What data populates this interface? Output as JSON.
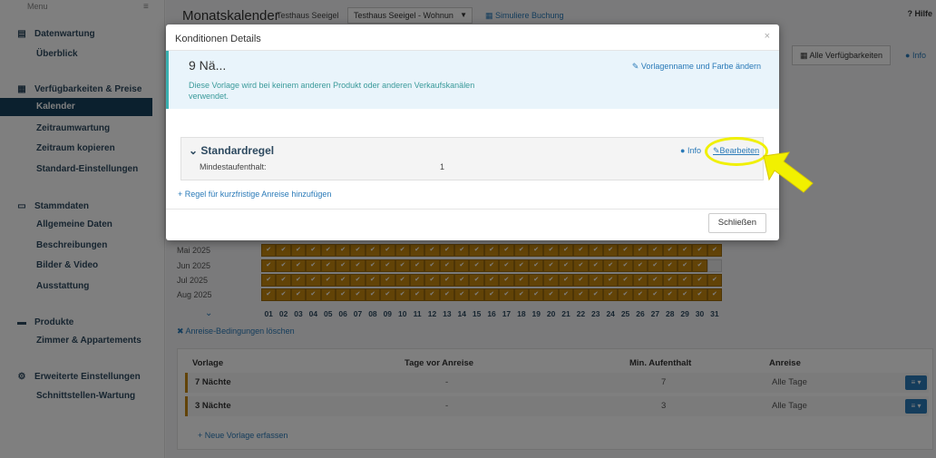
{
  "sidebar": {
    "menu_label": "Menu",
    "sections": [
      {
        "label": "Datenwartung",
        "items": [
          "Überblick"
        ]
      },
      {
        "label": "Verfügbarkeiten & Preise",
        "items": [
          "Kalender",
          "Zeitraumwartung",
          "Zeitraum kopieren",
          "Standard-Einstellungen"
        ]
      },
      {
        "label": "Stammdaten",
        "items": [
          "Allgemeine Daten",
          "Beschreibungen",
          "Bilder & Video",
          "Ausstattung"
        ]
      },
      {
        "label": "Produkte",
        "items": [
          "Zimmer & Appartements"
        ]
      },
      {
        "label": "Erweiterte Einstellungen",
        "items": [
          "Schnittstellen-Wartung"
        ]
      }
    ],
    "active_item": "Kalender"
  },
  "header": {
    "title": "Monatskalender",
    "property": "Testhaus Seeigel",
    "unit_select": "Testhaus Seeigel - Wohnun",
    "simulate": "Simuliere Buchung",
    "help": "? Hilfe",
    "availability_button": "Alle Verfügbarkeiten",
    "info_link": "Info"
  },
  "calendar": {
    "months": [
      "Mai 2025",
      "Jun 2025",
      "Jul 2025",
      "Aug 2025"
    ],
    "days": [
      "01",
      "02",
      "03",
      "04",
      "05",
      "06",
      "07",
      "08",
      "09",
      "10",
      "11",
      "12",
      "13",
      "14",
      "15",
      "16",
      "17",
      "18",
      "19",
      "20",
      "21",
      "22",
      "23",
      "24",
      "25",
      "26",
      "27",
      "28",
      "29",
      "30",
      "31"
    ],
    "clear_link": "Anreise-Bedingungen löschen"
  },
  "templates_table": {
    "headers": {
      "vorlage": "Vorlage",
      "tage": "Tage vor Anreise",
      "min": "Min. Aufenthalt",
      "anreise": "Anreise"
    },
    "rows": [
      {
        "name": "7 Nächte",
        "tage": "-",
        "min": "7",
        "anreise": "Alle Tage"
      },
      {
        "name": "3 Nächte",
        "tage": "-",
        "min": "3",
        "anreise": "Alle Tage"
      }
    ],
    "new_link": "Neue Vorlage erfassen"
  },
  "modal": {
    "title": "Konditionen Details",
    "close_glyph": "×",
    "template_name": "9 Nä...",
    "template_desc": "Diese Vorlage wird bei keinem anderen Produkt oder anderen Verkaufskanälen verwendet.",
    "rename_link": "Vorlagenname und Farbe ändern",
    "rule": {
      "title": "Standardregel",
      "label": "Mindestaufenthalt:",
      "value": "1",
      "info": "Info",
      "edit": "Bearbeiten"
    },
    "add_rule": "Regel für kurzfristige Anreise hinzufügen",
    "close_button": "Schließen"
  },
  "colors": {
    "accent": "#2a7ab8",
    "nav_active": "#16405d",
    "calendar_cell": "#c4870f",
    "highlight": "#f0f000"
  }
}
